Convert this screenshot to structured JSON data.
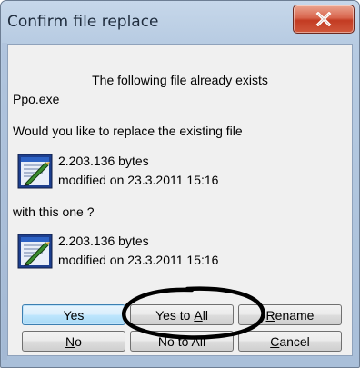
{
  "window": {
    "title": "Confirm file replace"
  },
  "dialog": {
    "heading": "The following file already exists",
    "filename": "Ppo.exe",
    "question": "Would you like to replace the existing file",
    "existing": {
      "size": "2.203.136 bytes",
      "modified": "modified on 23.3.2011 15:16"
    },
    "with_label": "with this one ?",
    "replacement": {
      "size": "2.203.136 bytes",
      "modified": "modified on 23.3.2011 15:16"
    }
  },
  "buttons": {
    "yes": {
      "label": "Yes"
    },
    "yes_to_all": {
      "pre": "Yes to ",
      "mnemonic": "A",
      "post": "ll"
    },
    "rename": {
      "pre": "",
      "mnemonic": "R",
      "post": "ename"
    },
    "no": {
      "pre": "",
      "mnemonic": "N",
      "post": "o"
    },
    "no_to_all": {
      "label": "No to All"
    },
    "cancel": {
      "pre": "",
      "mnemonic": "C",
      "post": "ancel"
    }
  },
  "annotation": {
    "description": "hand-drawn oval around Yes to All button",
    "color": "#000000"
  },
  "icons": {
    "close": "close-icon",
    "file": "executable-file-icon"
  }
}
